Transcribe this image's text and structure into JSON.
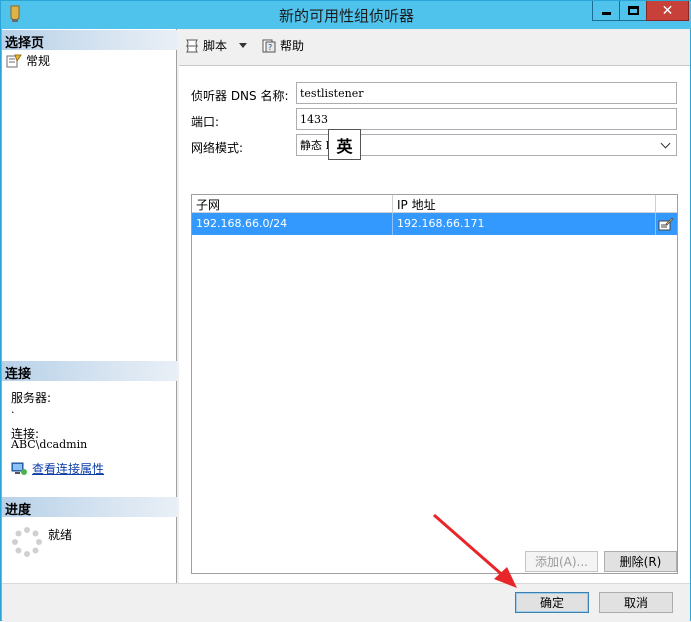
{
  "window": {
    "title": "新的可用性组侦听器",
    "minimize_glyph": "",
    "close_glyph": "✕"
  },
  "left_pane": {
    "select_page_header": "选择页",
    "nav_items": [
      {
        "label": "常规",
        "icon": "page-settings-icon"
      }
    ],
    "connection_header": "连接",
    "server_label": "服务器:",
    "server_value": ".",
    "connection_label": "连接:",
    "connection_value": "ABC\\dcadmin",
    "view_connection_link": "查看连接属性",
    "progress_header": "进度",
    "progress_status": "就绪"
  },
  "toolbar": {
    "script_label": "脚本",
    "help_label": "帮助"
  },
  "form": {
    "dns_label": "侦听器 DNS 名称:",
    "dns_value": "testlistener",
    "port_label": "端口:",
    "port_value": "1433",
    "ime_indicator": "英",
    "network_mode_label": "网络模式:",
    "network_mode_value": "静态 IP"
  },
  "grid": {
    "columns": [
      "子网",
      "IP 地址"
    ],
    "rows": [
      {
        "subnet": "192.168.66.0/24",
        "ip": "192.168.66.171",
        "selected": true
      }
    ]
  },
  "buttons": {
    "add_label": "添加(A)...",
    "remove_label": "删除(R)",
    "ok_label": "确定",
    "cancel_label": "取消"
  },
  "colors": {
    "titlebar": "#4fc3ec",
    "selection": "#3399ff",
    "close_button": "#c7403a",
    "annotation_arrow": "#e8262a"
  }
}
